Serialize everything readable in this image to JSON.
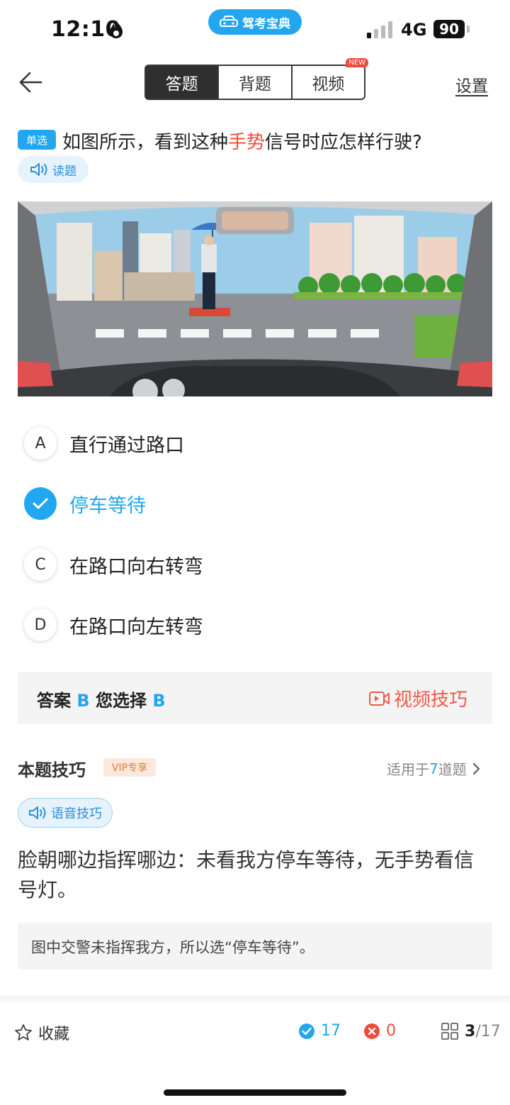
{
  "status_bar": {
    "time": "12:10",
    "app_label": "驾考宝典",
    "network": "4G",
    "battery": "90"
  },
  "nav": {
    "tabs": [
      {
        "label": "答题"
      },
      {
        "label": "背题"
      },
      {
        "label": "视频"
      }
    ],
    "new_badge": "NEW",
    "settings": "设置"
  },
  "question": {
    "type": "单选",
    "text_before": "如图所示，看到这种",
    "text_highlight": "手势",
    "text_after": "信号时应怎样行驶?",
    "read_label": "读题"
  },
  "options": [
    {
      "key": "A",
      "text": "直行通过路口",
      "selected": false
    },
    {
      "key": "B",
      "text": "停车等待",
      "selected": true
    },
    {
      "key": "C",
      "text": "在路口向右转弯",
      "selected": false
    },
    {
      "key": "D",
      "text": "在路口向左转弯",
      "selected": false
    }
  ],
  "answer": {
    "answer_label": "答案",
    "answer_value": "B",
    "chosen_label": "您选择",
    "chosen_value": "B",
    "video_tip": "视频技巧"
  },
  "tip": {
    "title": "本题技巧",
    "vip": "VIP专享",
    "applies_prefix": "适用于",
    "applies_count": "7",
    "applies_suffix": "道题",
    "voice_label": "语音技巧",
    "body": "脸朝哪边指挥哪边：未看我方停车等待，无手势看信号灯。",
    "note": "图中交警未指挥我方，所以选“停车等待”。"
  },
  "bottom": {
    "favorite": "收藏",
    "correct_count": "17",
    "wrong_count": "0",
    "current": "3",
    "total": "/17"
  },
  "colors": {
    "accent": "#23a6f0",
    "danger": "#ee4b3b",
    "vip": "#e07a3c"
  }
}
